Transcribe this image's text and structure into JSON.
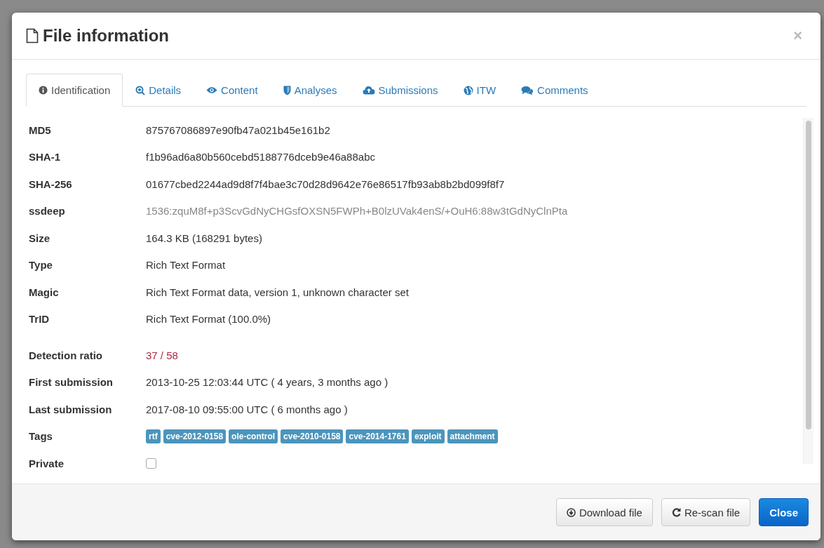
{
  "dialog": {
    "title": "File information",
    "close_symbol": "×"
  },
  "tabs": [
    {
      "label": "Identification",
      "kind": "info",
      "selected": true
    },
    {
      "label": "Details",
      "kind": "search",
      "selected": false
    },
    {
      "label": "Content",
      "kind": "eye",
      "selected": false
    },
    {
      "label": "Analyses",
      "kind": "shield",
      "selected": false
    },
    {
      "label": "Submissions",
      "kind": "cloud",
      "selected": false
    },
    {
      "label": "ITW",
      "kind": "globe",
      "selected": false
    },
    {
      "label": "Comments",
      "kind": "comments",
      "selected": false
    }
  ],
  "file_fields": [
    {
      "label": "MD5",
      "value": "875767086897e90fb47a021b45e161b2",
      "kind": "text"
    },
    {
      "label": "SHA-1",
      "value": "f1b96ad6a80b560cebd5188776dceb9e46a88abc",
      "kind": "text"
    },
    {
      "label": "SHA-256",
      "value": "01677cbed2244ad9d8f7f4bae3c70d28d9642e76e86517fb93ab8b2bd099f8f7",
      "kind": "text"
    },
    {
      "label": "ssdeep",
      "value": "1536:zquM8f+p3ScvGdNyCHGsfOXSN5FWPh+B0lzUVak4enS/+OuH6:88w3tGdNyClnPta",
      "kind": "muted"
    },
    {
      "label": "Size",
      "value": "164.3 KB (168291 bytes)",
      "kind": "text"
    },
    {
      "label": "Type",
      "value": "Rich Text Format",
      "kind": "text"
    },
    {
      "label": "Magic",
      "value": "Rich Text Format data, version 1, unknown character set",
      "kind": "text"
    },
    {
      "label": "TrID",
      "value": "Rich Text Format (100.0%)",
      "kind": "text"
    }
  ],
  "scan_fields": [
    {
      "label": "Detection ratio",
      "value": "37 / 58",
      "kind": "alert"
    },
    {
      "label": "First submission",
      "value": "2013-10-25 12:03:44 UTC ( 4 years, 3 months ago )",
      "kind": "text"
    },
    {
      "label": "Last submission",
      "value": "2017-08-10 09:55:00 UTC ( 6 months ago )",
      "kind": "text"
    },
    {
      "label": "Tags",
      "tags": [
        "rtf",
        "cve-2012-0158",
        "ole-control",
        "cve-2010-0158",
        "cve-2014-1761",
        "exploit",
        "attachment"
      ],
      "kind": "tags"
    },
    {
      "label": "Private",
      "checked": false,
      "kind": "checkbox"
    }
  ],
  "buttons": [
    {
      "label": "Download file",
      "kind": "download"
    },
    {
      "label": "Re-scan file",
      "kind": "refresh"
    },
    {
      "label": "Close",
      "kind": "primary"
    }
  ]
}
